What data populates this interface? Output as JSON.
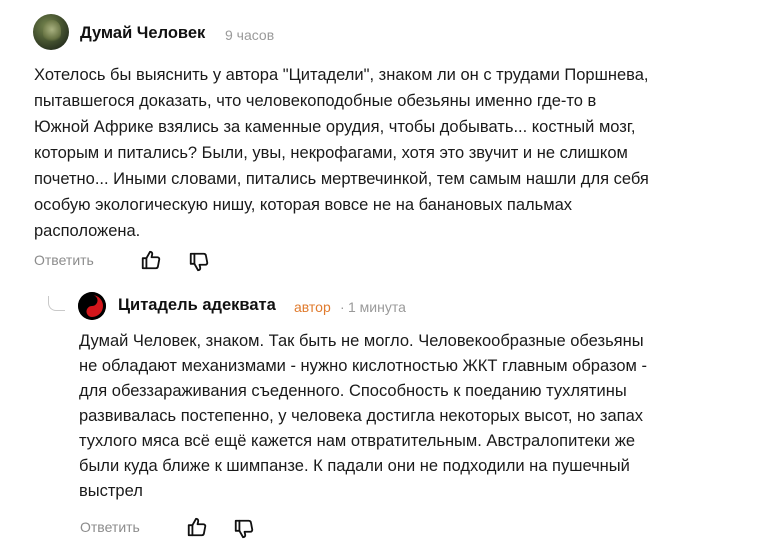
{
  "comments": [
    {
      "author": "Думай Человек",
      "time": "9 часов",
      "text_lines": [
        "Хотелось бы выяснить у автора \"Цитадели\", знаком ли он с трудами Поршнева,",
        "пытавшегося доказать, что человекоподобные обезьяны именно где-то в",
        "Южной Африке взялись за каменные орудия, чтобы добывать... костный мозг,",
        "которым и питались? Были, увы, некрофагами, хотя это звучит и не слишком",
        "почетно... Иными словами, питались мертвечинкой, тем самым нашли для себя",
        "особую экологическую нишу, которая вовсе не на банановых пальмах",
        "расположена."
      ],
      "reply_label": "Ответить",
      "like_icon": "thumb-up-icon",
      "dislike_icon": "thumb-down-icon"
    },
    {
      "author": "Цитадель адеквата",
      "badge": "автор",
      "separator": "·",
      "time": "1 минута",
      "text_lines": [
        "Думай Человек, знаком. Так быть не могло. Человекообразные обезьяны",
        "не обладают механизмами - нужно кислотностью ЖКТ главным образом -",
        "для обеззараживания съеденного. Способность к поеданию тухлятины",
        "развивалась постепенно, у человека достигла некоторых высот, но запах",
        "тухлого мяса всё ещё кажется нам отвратительным. Австралопитеки же",
        "были куда ближе к шимпанзе. К падали они не подходили на пушечный",
        "выстрел"
      ],
      "reply_label": "Ответить",
      "like_icon": "thumb-up-icon",
      "dislike_icon": "thumb-down-icon"
    }
  ],
  "colors": {
    "author_badge": "#e07b2e",
    "muted": "#8c8c8c",
    "avatar2_accent": "#d3161b"
  }
}
